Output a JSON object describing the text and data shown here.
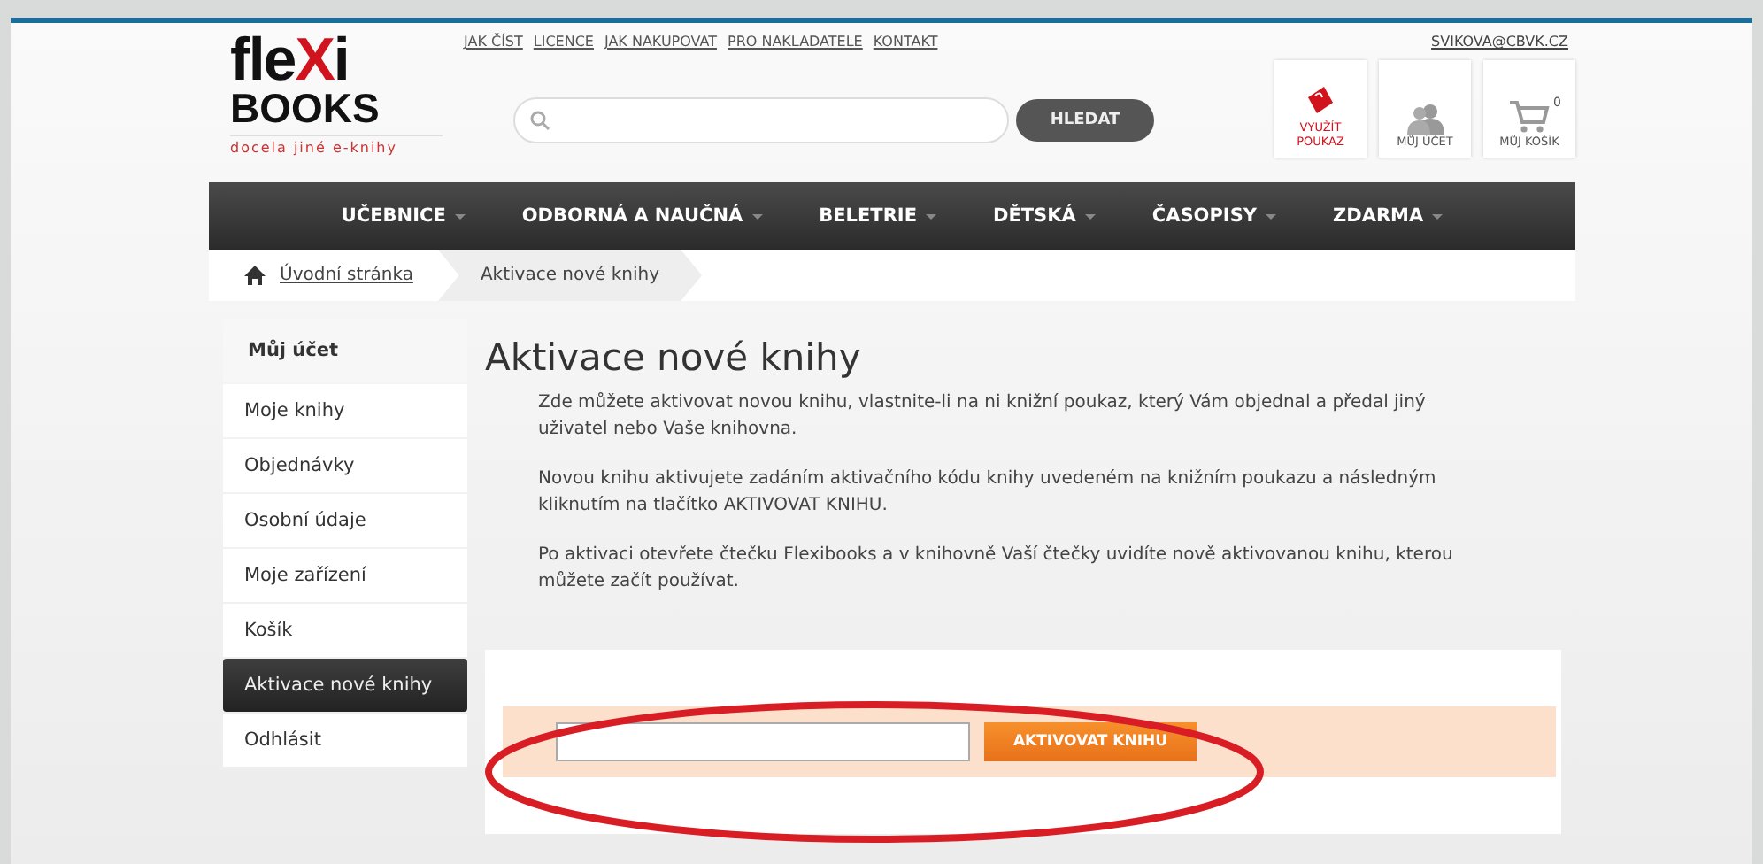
{
  "logo": {
    "word_start": "fle",
    "word_mark": "X",
    "word_end": "i",
    "line2": "BOOKS",
    "tagline": "docela jiné e-knihy"
  },
  "top_links": [
    "JAK ČÍST",
    "LICENCE",
    "JAK NAKUPOVAT",
    "PRO NAKLADATELE",
    "KONTAKT"
  ],
  "user_email": "SVIKOVA@CBVK.CZ",
  "search": {
    "button": "HLEDAT"
  },
  "header_buttons": [
    {
      "kind": "voucher",
      "label": "VYUŽÍT POUKAZ"
    },
    {
      "kind": "account",
      "label": "MŮJ ÚČET"
    },
    {
      "kind": "cart",
      "label": "MŮJ KOŠÍK",
      "count": "0"
    }
  ],
  "nav": [
    "UČEBNICE",
    "ODBORNÁ A NAUČNÁ",
    "BELETRIE",
    "DĚTSKÁ",
    "ČASOPISY",
    "ZDARMA"
  ],
  "breadcrumb": [
    "Úvodní stránka",
    "Aktivace nové knihy"
  ],
  "sidebar": {
    "title": "Můj účet",
    "items": [
      {
        "label": "Moje knihy",
        "selected": false
      },
      {
        "label": "Objednávky",
        "selected": false
      },
      {
        "label": "Osobní údaje",
        "selected": false
      },
      {
        "label": "Moje zařízení",
        "selected": false
      },
      {
        "label": "Košík",
        "selected": false
      },
      {
        "label": "Aktivace nové knihy",
        "selected": true
      },
      {
        "label": "Odhlásit",
        "selected": false
      }
    ]
  },
  "heading": "Aktivace nové knihy",
  "paragraphs": [
    "Zde můžete aktivovat novou knihu, vlastnite-li na ni knižní poukaz, který Vám objednal a předal jiný uživatel nebo Vaše knihovna.",
    "Novou knihu aktivujete zadáním aktivačního kódu knihy uvedeném na knižním poukazu a následným kliknutím na tlačítko AKTIVOVAT KNIHU.",
    "Po aktivaci otevřete čtečku Flexibooks a v knihovně Vaší čtečky uvidíte nově aktivovanou knihu, kterou můžete začít používat."
  ],
  "activation": {
    "button": "AKTIVOVAT KNIHU",
    "highlighted": true
  }
}
